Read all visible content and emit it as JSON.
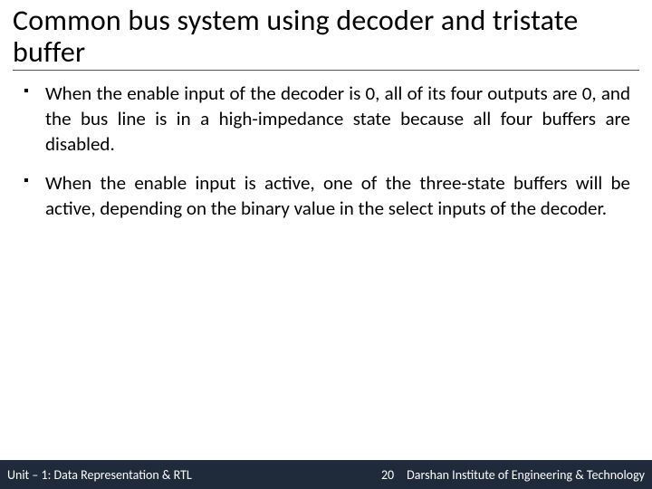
{
  "title": "Common bus system using decoder and tristate buffer",
  "bullets": [
    "When the enable input of the decoder is 0, all of its four outputs are 0, and the bus line is in a high-impedance state because all four buffers are disabled.",
    "When the enable input is active, one of the three-state buffers will be active, depending on the binary value in the select inputs of the decoder."
  ],
  "footer": {
    "unit": "Unit – 1: Data Representation & RTL",
    "page": "20",
    "institute": "Darshan Institute of Engineering & Technology"
  }
}
